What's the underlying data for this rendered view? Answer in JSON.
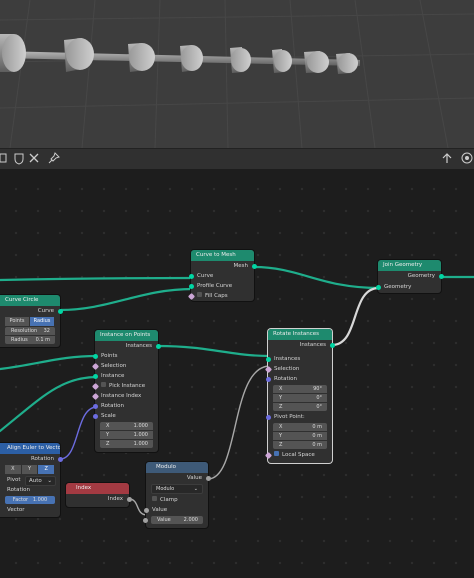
{
  "toolbar": {
    "right_icons": [
      "overlay-icon",
      "node-tree-icon"
    ]
  },
  "nodes": {
    "curve_to_mesh": {
      "title": "Curve to Mesh",
      "out_mesh": "Mesh",
      "in_curve": "Curve",
      "in_profile": "Profile Curve",
      "fill_caps": "Fill Caps"
    },
    "join_geometry": {
      "title": "Join Geometry",
      "out_geometry": "Geometry",
      "in_geometry": "Geometry"
    },
    "curve_circle": {
      "title": "Curve Circle",
      "out_curve": "Curve",
      "mode_points": "Points",
      "mode_radius": "Radius",
      "resolution_label": "Resolution",
      "resolution_value": "32",
      "radius_label": "Radius",
      "radius_value": "0.1 m"
    },
    "instance_on_points": {
      "title": "Instance on Points",
      "out_instances": "Instances",
      "in_points": "Points",
      "in_selection": "Selection",
      "in_instance": "Instance",
      "pick_instance": "Pick Instance",
      "in_instance_index": "Instance Index",
      "in_rotation": "Rotation",
      "in_scale": "Scale",
      "scale_x_label": "X",
      "scale_x_value": "1.000",
      "scale_y_label": "Y",
      "scale_y_value": "1.000",
      "scale_z_label": "Z",
      "scale_z_value": "1.000"
    },
    "rotate_instances": {
      "title": "Rotate Instances",
      "out_instances": "Instances",
      "in_instances": "Instances",
      "in_selection": "Selection",
      "in_rotation": "Rotation",
      "rot_x_label": "X",
      "rot_x_value": "90°",
      "rot_y_label": "Y",
      "rot_y_value": "0°",
      "rot_z_label": "Z",
      "rot_z_value": "0°",
      "pivot_label": "Pivot Point:",
      "piv_x_label": "X",
      "piv_x_value": "0 m",
      "piv_y_label": "Y",
      "piv_y_value": "0 m",
      "piv_z_label": "Z",
      "piv_z_value": "0 m",
      "local_space": "Local Space"
    },
    "align_euler": {
      "title": "Align Euler to Vector",
      "out_rotation": "Rotation",
      "axis_x": "X",
      "axis_y": "Y",
      "axis_z": "Z",
      "pivot_label": "Pivot",
      "pivot_value": "Auto",
      "in_rotation": "Rotation",
      "factor_label": "Factor",
      "factor_value": "1.000",
      "in_vector": "Vector"
    },
    "index": {
      "title": "Index",
      "out_index": "Index"
    },
    "modulo": {
      "title": "Modulo",
      "out_value": "Value",
      "operation": "Modulo",
      "clamp": "Clamp",
      "in_value": "Value",
      "value_label": "Value",
      "value_value": "2.000"
    }
  },
  "colors": {
    "geometry_socket": "#00d6a3",
    "vector_socket": "#6363c7",
    "float_socket": "#a1a1a1",
    "geometry_header": "#1e8a6e",
    "converter_header": "#2c5fa5",
    "input_header": "#a33a42",
    "selected_field": "#4772b3"
  }
}
